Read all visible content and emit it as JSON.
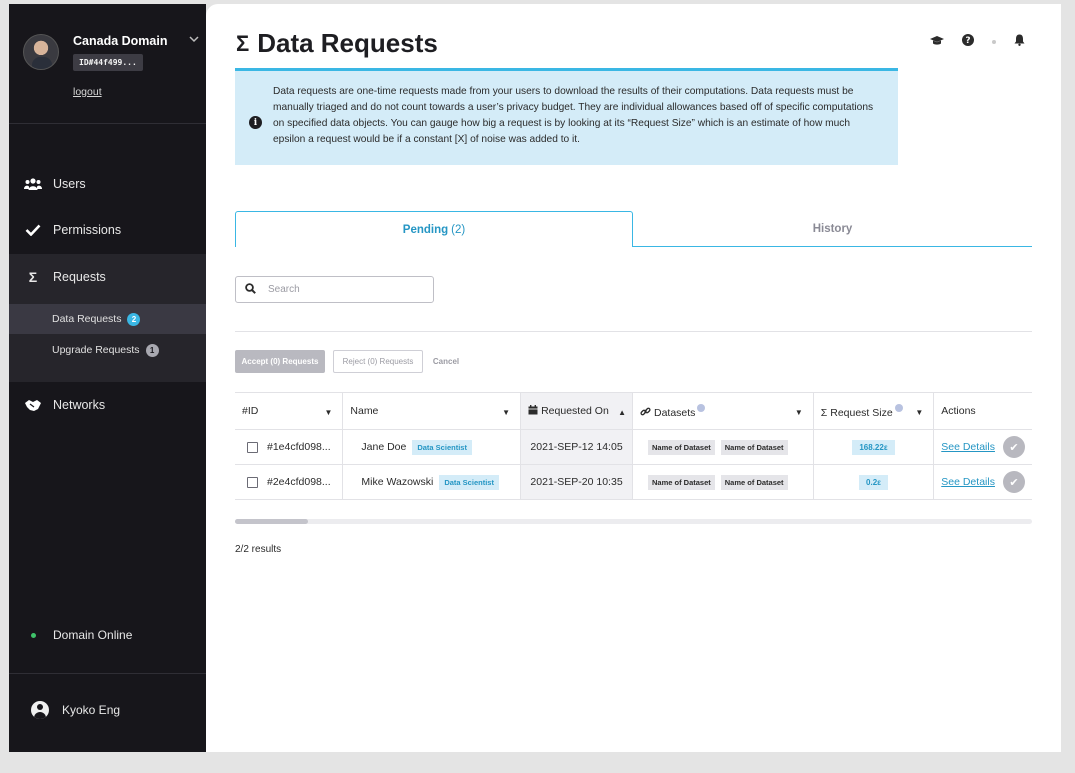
{
  "sidebar": {
    "domain_name": "Canada Domain",
    "domain_id": "ID#44f499...",
    "logout_label": "logout",
    "nav": {
      "users": "Users",
      "permissions": "Permissions",
      "requests": "Requests",
      "networks": "Networks"
    },
    "sub_items": [
      {
        "label": "Data Requests",
        "badge": "2"
      },
      {
        "label": "Upgrade Requests",
        "badge": "1"
      }
    ],
    "status": "Domain Online",
    "user_name": "Kyoko Eng"
  },
  "header": {
    "title": "Data Requests",
    "title_icon": "sigma",
    "icons": [
      "graduation-cap-icon",
      "help-icon",
      "status-dot",
      "bell-icon"
    ]
  },
  "info_text": "Data requests are one-time requests made from your users to download the results of their computations. Data requests must be manually triaged and do not count towards a user’s privacy budget. They are individual allowances based off of specific computations on specified data objects. You can gauge how big a request is by looking at its “Request Size” which is an estimate of how much epsilon a request would be if a constant [X] of noise was added to it.",
  "tabs": {
    "pending_label": "Pending",
    "pending_count": "(2)",
    "history_label": "History"
  },
  "search": {
    "placeholder": "Search"
  },
  "actions": {
    "accept": "Accept (0) Requests",
    "reject": "Reject (0) Requests",
    "cancel": "Cancel"
  },
  "table": {
    "columns": {
      "id": "#ID",
      "name": "Name",
      "requested_on": "Requested On",
      "datasets": "Datasets",
      "request_size": "Request Size",
      "actions": "Actions"
    },
    "rows": [
      {
        "id": "#1e4cfd098...",
        "name": "Jane Doe",
        "role": "Data Scientist",
        "requested_on": "2021-SEP-12 14:05",
        "datasets": [
          "Name of Dataset",
          "Name of Dataset"
        ],
        "size": "168.22ε",
        "details": "See Details"
      },
      {
        "id": "#2e4cfd098...",
        "name": "Mike Wazowski",
        "role": "Data Scientist",
        "requested_on": "2021-SEP-20 10:35",
        "datasets": [
          "Name of Dataset",
          "Name of Dataset"
        ],
        "size": "0.2ε",
        "details": "See Details"
      }
    ]
  },
  "results": "2/2 results",
  "colors": {
    "accent": "#3ab7e4",
    "sidebar_bg": "#17161b",
    "online": "#3fc36a"
  }
}
